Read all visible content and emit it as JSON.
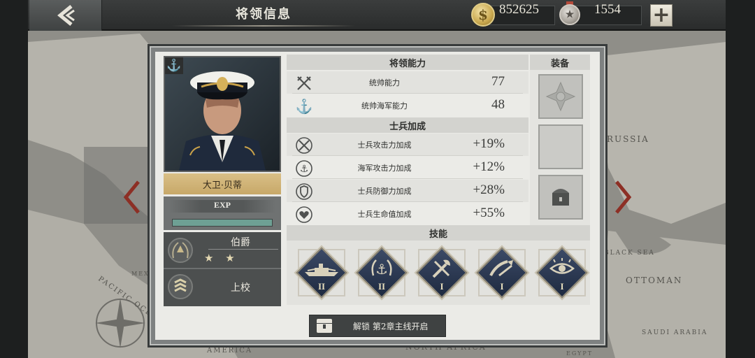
{
  "header": {
    "title": "将领信息",
    "gold": "852625",
    "medals": "1554"
  },
  "map": {
    "labels": [
      "RUSSIA",
      "OTTOMAN",
      "BLACK SEA",
      "SAUDI ARABIA",
      "NORTH AFRICA",
      "AMERICA",
      "PACIFIC OCEAN",
      "MEXICO",
      "EGYPT"
    ]
  },
  "general": {
    "name": "大卫·贝蒂",
    "exp_label": "EXP",
    "exp_fraction": 1.0,
    "noble_title": "伯爵",
    "noble_stars": "★ ★",
    "military_rank": "上校"
  },
  "abilities": {
    "header": "将领能力",
    "rows": [
      {
        "label": "统帅能力",
        "value": "77",
        "icon": "crossed-swords-icon"
      },
      {
        "label": "统帅海军能力",
        "value": "48",
        "icon": "anchor-icon"
      }
    ]
  },
  "soldier_bonus": {
    "header": "士兵加成",
    "rows": [
      {
        "label": "士兵攻击力加成",
        "value": "+19%",
        "icon": "attack-bonus-icon"
      },
      {
        "label": "海军攻击力加成",
        "value": "+12%",
        "icon": "naval-attack-icon"
      },
      {
        "label": "士兵防御力加成",
        "value": "+28%",
        "icon": "defense-icon"
      },
      {
        "label": "士兵生命值加成",
        "value": "+55%",
        "icon": "health-icon"
      }
    ]
  },
  "equipment": {
    "header": "装备"
  },
  "skills": {
    "header": "技能",
    "items": [
      {
        "level": "II",
        "icon": "battleship-icon"
      },
      {
        "level": "II",
        "icon": "anchor-wreath-icon"
      },
      {
        "level": "I",
        "icon": "tools-icon"
      },
      {
        "level": "I",
        "icon": "cannon-icon"
      },
      {
        "level": "I",
        "icon": "eye-icon"
      }
    ]
  },
  "unlock": {
    "text": "解锁 第2章主线开启"
  },
  "colors": {
    "panel_bg": "#ebebe7",
    "gold_plate": "#c7a869",
    "skill_blue": "#2a3854"
  }
}
